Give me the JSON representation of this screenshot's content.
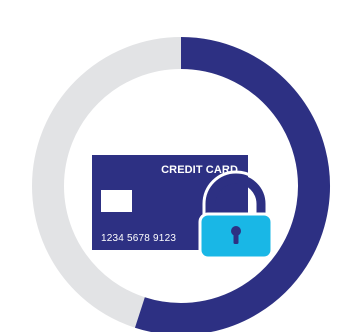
{
  "card": {
    "title": "CREDIT CARD",
    "number": "1234 5678 9123"
  },
  "ring": {
    "fraction": 0.55
  },
  "colors": {
    "ring_track": "#e2e3e5",
    "ring_fill": "#2d3083",
    "card": "#2d3083",
    "card_text": "#ffffff",
    "lock_body": "#19b7e6",
    "lock_shackle": "#2d3083",
    "lock_outline": "#ffffff",
    "keyhole": "#2d3083"
  },
  "icons": {
    "card": "credit-card-icon",
    "chip": "card-chip-icon",
    "lock": "padlock-icon"
  }
}
